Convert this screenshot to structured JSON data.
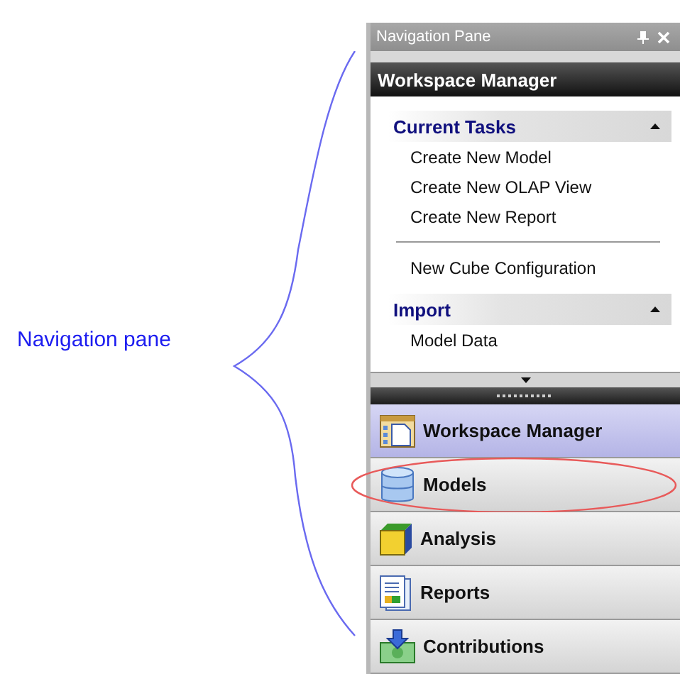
{
  "annotation": {
    "label": "Navigation pane"
  },
  "pane": {
    "title": "Navigation Pane",
    "header": "Workspace Manager",
    "groups": [
      {
        "title": "Current Tasks",
        "expanded": true,
        "items": [
          {
            "kind": "link",
            "label": "Create New Model"
          },
          {
            "kind": "link",
            "label": "Create New OLAP View"
          },
          {
            "kind": "link",
            "label": "Create New Report"
          },
          {
            "kind": "separator"
          },
          {
            "kind": "link",
            "label": "New Cube Configuration"
          }
        ]
      },
      {
        "title": "Import",
        "expanded": true,
        "items": [
          {
            "kind": "link",
            "label": "Model Data"
          }
        ]
      }
    ],
    "nav_buttons": [
      {
        "label": "Workspace Manager",
        "selected": true,
        "circled": false
      },
      {
        "label": "Models",
        "selected": false,
        "circled": true
      },
      {
        "label": "Analysis",
        "selected": false,
        "circled": false
      },
      {
        "label": "Reports",
        "selected": false,
        "circled": false
      },
      {
        "label": "Contributions",
        "selected": false,
        "circled": false
      }
    ]
  }
}
